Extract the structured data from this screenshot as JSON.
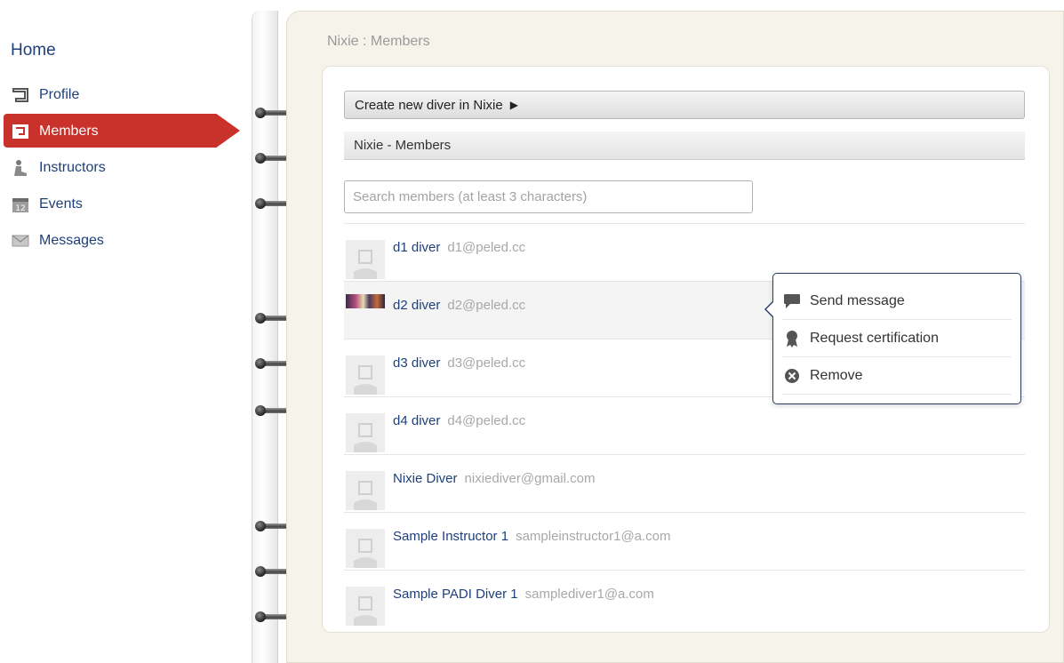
{
  "sidebar": {
    "home_label": "Home",
    "items": [
      {
        "label": "Profile",
        "icon": "profile-icon"
      },
      {
        "label": "Members",
        "icon": "members-icon",
        "active": true
      },
      {
        "label": "Instructors",
        "icon": "instructors-icon"
      },
      {
        "label": "Events",
        "icon": "calendar-icon",
        "badge": "12"
      },
      {
        "label": "Messages",
        "icon": "envelope-icon"
      }
    ],
    "active_color": "#c9322a"
  },
  "page": {
    "title": "Nixie : Members",
    "create_label": "Create new diver in Nixie",
    "create_arrow": "▶",
    "section_title": "Nixie - Members",
    "search_placeholder": "Search members (at least 3 characters)"
  },
  "members": [
    {
      "name": "d1 diver",
      "email": "d1@peled.cc"
    },
    {
      "name": "d2 diver",
      "email": "d2@peled.cc",
      "has_photo": true
    },
    {
      "name": "d3 diver",
      "email": "d3@peled.cc"
    },
    {
      "name": "d4 diver",
      "email": "d4@peled.cc"
    },
    {
      "name": "Nixie Diver",
      "email": "nixiediver@gmail.com"
    },
    {
      "name": "Sample Instructor 1",
      "email": "sampleinstructor1@a.com"
    },
    {
      "name": "Sample PADI Diver 1",
      "email": "samplediver1@a.com"
    }
  ],
  "context_menu": {
    "items": [
      {
        "label": "Send message",
        "icon": "speech-bubble-icon"
      },
      {
        "label": "Request certification",
        "icon": "ribbon-award-icon"
      },
      {
        "label": "Remove",
        "icon": "remove-circle-icon"
      }
    ]
  }
}
